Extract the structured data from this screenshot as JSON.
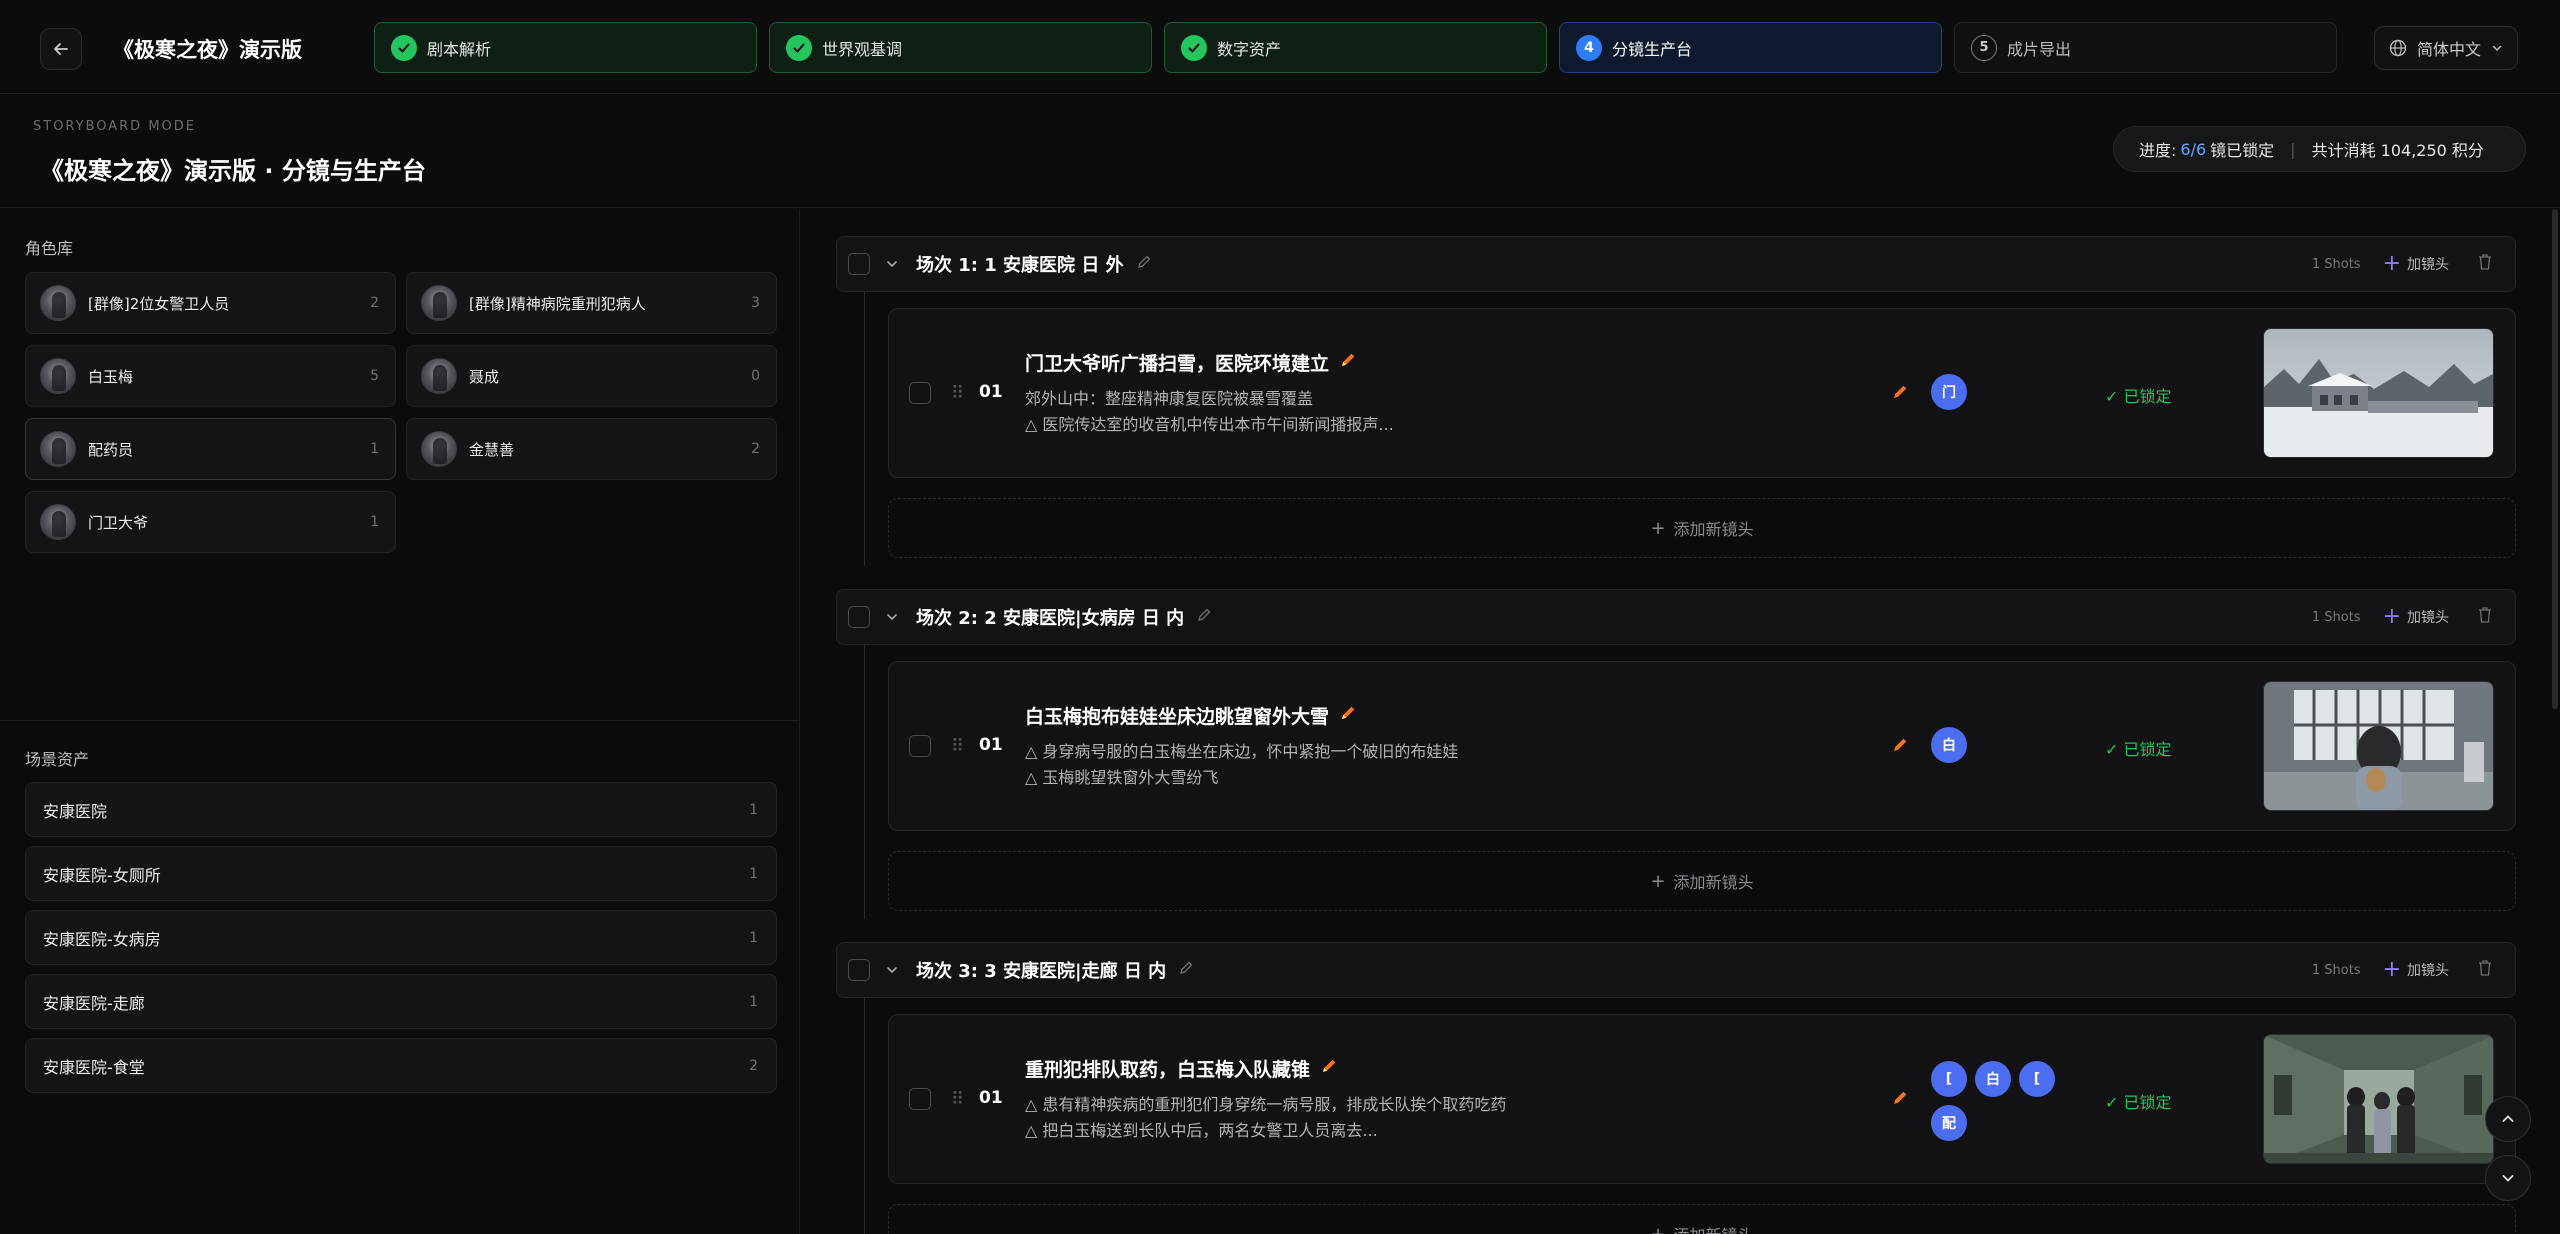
{
  "app": {
    "title": "《极寒之夜》演示版",
    "language": "简体中文"
  },
  "steps": [
    {
      "label": "剧本解析",
      "state": "done",
      "number": "1"
    },
    {
      "label": "世界观基调",
      "state": "done",
      "number": "2"
    },
    {
      "label": "数字资产",
      "state": "done",
      "number": "3"
    },
    {
      "label": "分镜生产台",
      "state": "active",
      "number": "4"
    },
    {
      "label": "成片导出",
      "state": "todo",
      "number": "5"
    }
  ],
  "header": {
    "mode": "STORYBOARD MODE",
    "title": "《极寒之夜》演示版 · 分镜与生产台",
    "progress_prefix": "进度:",
    "progress_value": "6/6",
    "progress_suffix": "镜已锁定",
    "cost": "共计消耗 104,250 积分"
  },
  "character_library": {
    "title": "角色库",
    "items": [
      {
        "name": "[群像]2位女警卫人员",
        "count": "2"
      },
      {
        "name": "[群像]精神病院重刑犯病人",
        "count": "3"
      },
      {
        "name": "白玉梅",
        "count": "5"
      },
      {
        "name": "聂成",
        "count": "0"
      },
      {
        "name": "配药员",
        "count": "1"
      },
      {
        "name": "金慧善",
        "count": "2"
      },
      {
        "name": "门卫大爷",
        "count": "1"
      }
    ]
  },
  "scene_assets": {
    "title": "场景资产",
    "items": [
      {
        "name": "安康医院",
        "count": "1"
      },
      {
        "name": "安康医院-女厕所",
        "count": "1"
      },
      {
        "name": "安康医院-女病房",
        "count": "1"
      },
      {
        "name": "安康医院-走廊",
        "count": "1"
      },
      {
        "name": "安康医院-食堂",
        "count": "2"
      }
    ]
  },
  "scenes": [
    {
      "title": "场次 1: 1 安康医院 日 外",
      "shots_count": "1 Shots",
      "add_shot_label": "加镜头",
      "shots": [
        {
          "number": "01",
          "title": "门卫大爷听广播扫雪，医院环境建立",
          "lines": [
            "郊外山中：整座精神康复医院被暴雪覆盖",
            "△ 医院传达室的收音机中传出本市午间新闻播报声..."
          ],
          "chips": [
            "门"
          ],
          "status": "✓ 已锁定"
        }
      ],
      "add_row_label": "添加新镜头"
    },
    {
      "title": "场次 2: 2 安康医院|女病房 日 内",
      "shots_count": "1 Shots",
      "add_shot_label": "加镜头",
      "shots": [
        {
          "number": "01",
          "title": "白玉梅抱布娃娃坐床边眺望窗外大雪",
          "lines": [
            "△ 身穿病号服的白玉梅坐在床边，怀中紧抱一个破旧的布娃娃",
            "△ 玉梅眺望铁窗外大雪纷飞"
          ],
          "chips": [
            "白"
          ],
          "status": "✓ 已锁定"
        }
      ],
      "add_row_label": "添加新镜头"
    },
    {
      "title": "场次 3: 3 安康医院|走廊 日 内",
      "shots_count": "1 Shots",
      "add_shot_label": "加镜头",
      "shots": [
        {
          "number": "01",
          "title": "重刑犯排队取药，白玉梅入队藏锥",
          "lines": [
            "△ 患有精神疾病的重刑犯们身穿统一病号服，排成长队挨个取药吃药",
            "△ 把白玉梅送到长队中后，两名女警卫人员离去..."
          ],
          "chips": [
            "[",
            "白",
            "[",
            "配"
          ],
          "status": "✓ 已锁定"
        }
      ],
      "add_row_label": "添加新镜头"
    }
  ],
  "colors": {
    "accent_blue": "#2f7cf6",
    "done_green": "#22c55e",
    "chip_blue": "#4d6df0",
    "pencil_orange": "#f97316"
  }
}
